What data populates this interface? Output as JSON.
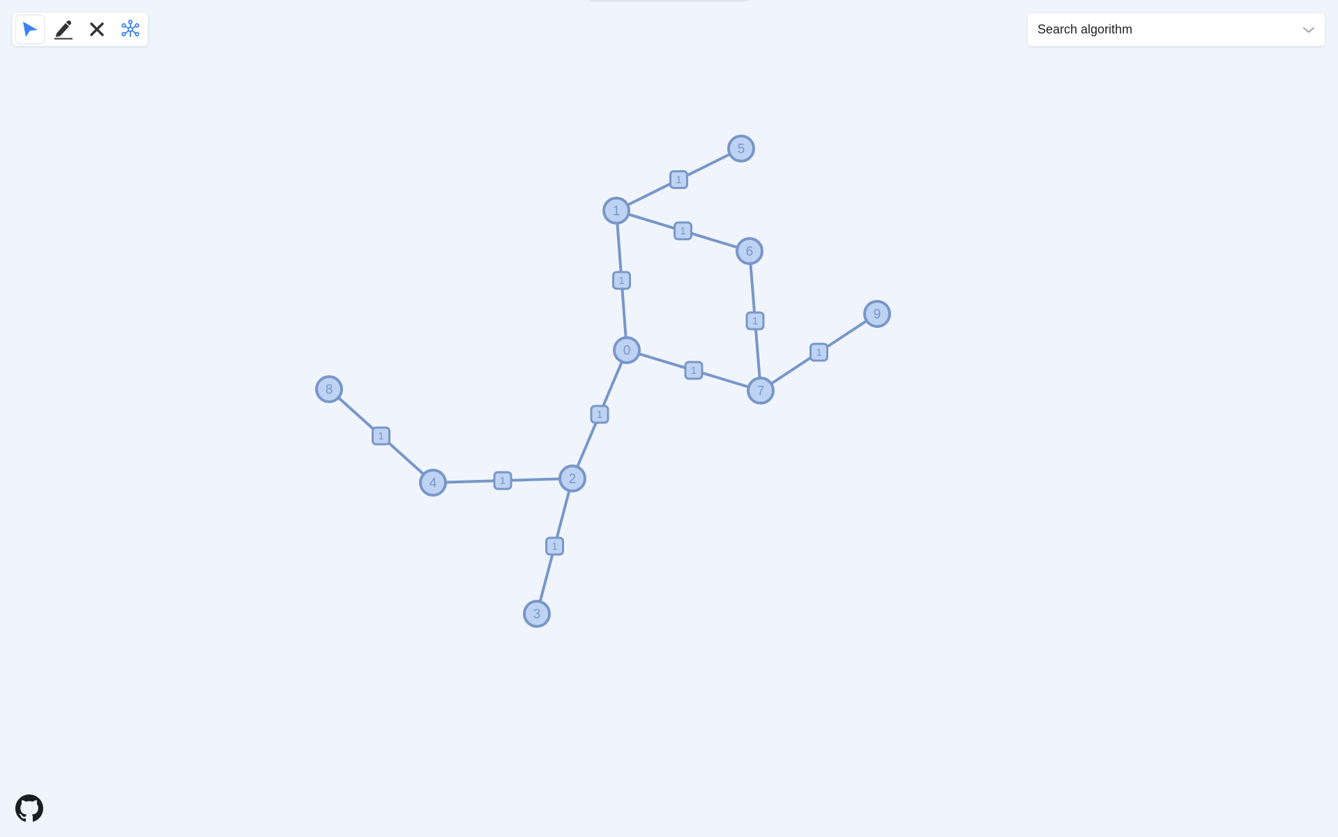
{
  "toolbar": {
    "tools": [
      {
        "id": "select",
        "icon": "pointer-arrow-icon",
        "active": true
      },
      {
        "id": "draw",
        "icon": "pen-icon",
        "active": false
      },
      {
        "id": "delete",
        "icon": "close-icon",
        "active": false
      },
      {
        "id": "generate",
        "icon": "graph-network-icon",
        "active": false
      }
    ]
  },
  "algorithm_select": {
    "label": "Search algorithm",
    "icon": "chevron-down-icon"
  },
  "graph": {
    "nodes": [
      "0",
      "1",
      "2",
      "3",
      "4",
      "5",
      "6",
      "7",
      "8",
      "9"
    ],
    "edges": [
      {
        "from": "1",
        "to": "5",
        "weight": "1"
      },
      {
        "from": "1",
        "to": "6",
        "weight": "1"
      },
      {
        "from": "1",
        "to": "0",
        "weight": "1"
      },
      {
        "from": "6",
        "to": "7",
        "weight": "1"
      },
      {
        "from": "0",
        "to": "7",
        "weight": "1"
      },
      {
        "from": "7",
        "to": "9",
        "weight": "1"
      },
      {
        "from": "0",
        "to": "2",
        "weight": "1"
      },
      {
        "from": "2",
        "to": "4",
        "weight": "1"
      },
      {
        "from": "4",
        "to": "8",
        "weight": "1"
      },
      {
        "from": "2",
        "to": "3",
        "weight": "1"
      }
    ],
    "colors": {
      "node_fill": "#bed3f3",
      "stroke": "#7896c8",
      "label": "#7896c8"
    }
  },
  "footer": {
    "icon": "github-icon"
  }
}
